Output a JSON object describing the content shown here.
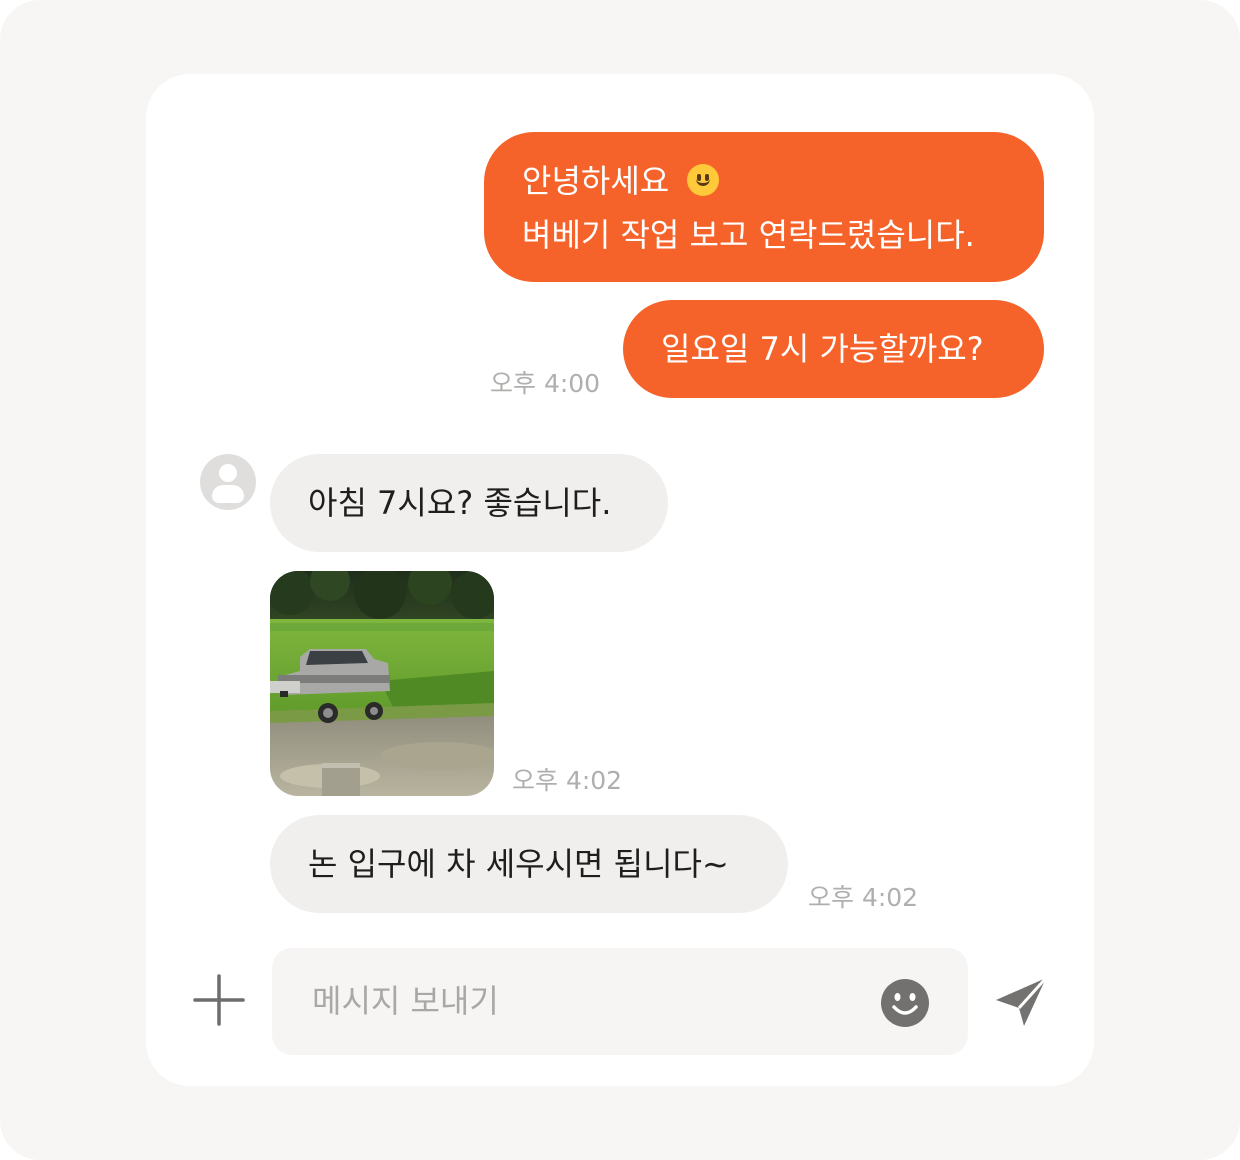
{
  "messages": [
    {
      "direction": "outgoing",
      "line1": "안녕하세요",
      "emoji": "slightly-smiling-face",
      "line2": "벼베기 작업 보고 연락드렸습니다."
    },
    {
      "direction": "outgoing",
      "text": "일요일 7시 가능할까요?",
      "time": "오후 4:00"
    },
    {
      "direction": "incoming",
      "text": "아침 7시요? 좋습니다."
    },
    {
      "direction": "incoming",
      "type": "image",
      "subject": "pickup truck parked beside rice field",
      "time": "오후 4:02"
    },
    {
      "direction": "incoming",
      "text": "논 입구에 차 세우시면 됩니다~",
      "time": "오후 4:02"
    }
  ],
  "composer": {
    "placeholder": "메시지 보내기",
    "attach_icon": "plus-icon",
    "emoji_icon": "smile-icon",
    "send_icon": "send-icon"
  },
  "colors": {
    "outgoing_bubble": "#f6632a",
    "incoming_bubble": "#f1efed",
    "timestamp": "#b1afad"
  }
}
